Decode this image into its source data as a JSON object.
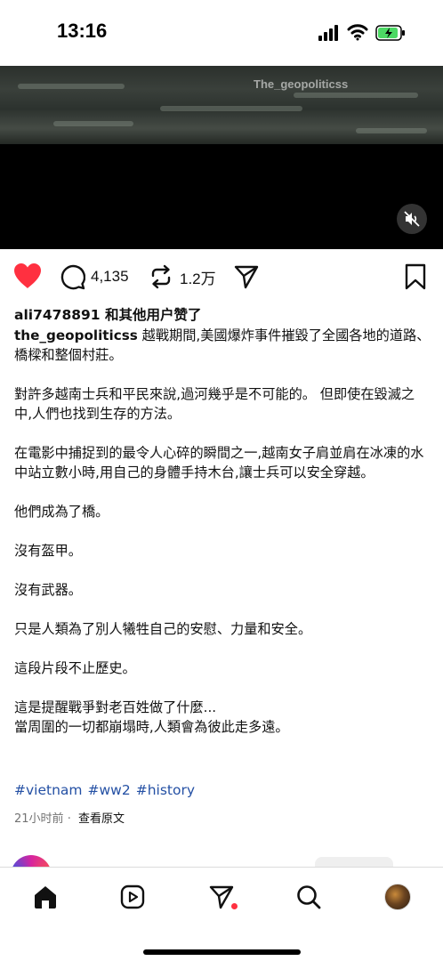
{
  "status_bar": {
    "time": "13:16"
  },
  "video": {
    "watermark": "The_geopoliticss"
  },
  "actions": {
    "comments_count": "4,135",
    "reposts_count": "1.2万"
  },
  "post": {
    "liked_by": "ali7478891 和其他用户赞了",
    "author": "the_geopoliticss",
    "paragraphs": [
      "越戰期間,美國爆炸事件摧毀了全國各地的道路、橋樑和整個村莊。",
      "對許多越南士兵和平民來說,過河幾乎是不可能的。 但即使在毀滅之中,人們也找到生存的方法。",
      "在電影中捕捉到的最令人心碎的瞬間之一,越南女子肩並肩在冰凍的水中站立數小時,用自己的身體手持木台,讓士兵可以安全穿越。",
      "他們成為了橋。",
      "沒有盔甲。",
      "沒有武器。",
      "只是人類為了別人犧牲自己的安慰、力量和安全。",
      "這段片段不止歷史。",
      "這是提醒戰爭對老百姓做了什麼...",
      "當周圍的一切都崩塌時,人類會為彼此走多遠。"
    ],
    "hashtags": [
      "#vietnam",
      "#ww2",
      "#history"
    ],
    "time_ago": "21小时前",
    "separator": "·",
    "see_original": "查看原文"
  },
  "colors": {
    "like_red": "#ff3040",
    "hashtag_blue": "#2450a4",
    "meta_gray": "#737373"
  },
  "icons": [
    "heart-icon",
    "comment-icon",
    "repost-icon",
    "share-icon",
    "bookmark-icon",
    "mute-icon",
    "home-icon",
    "reels-icon",
    "direct-icon",
    "search-icon"
  ]
}
